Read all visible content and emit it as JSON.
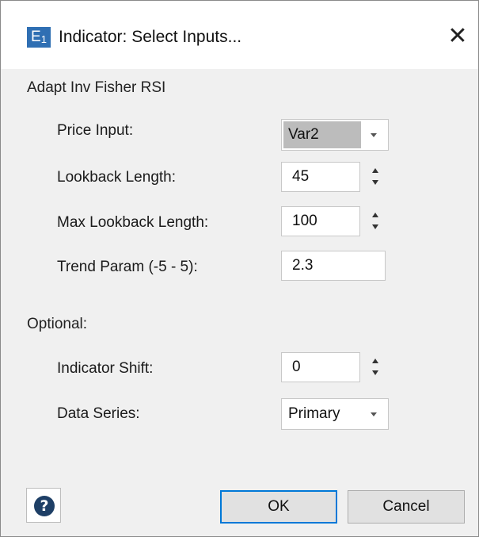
{
  "window": {
    "app_icon_letter": "E",
    "app_icon_sub": "1",
    "title": "Indicator: Select Inputs...",
    "close_glyph": "✕"
  },
  "main": {
    "section_title": "Adapt Inv Fisher RSI",
    "fields": [
      {
        "label": "Price Input:",
        "value": "Var2",
        "type": "dropdown"
      },
      {
        "label": "Lookback Length:",
        "value": "45",
        "type": "spinner"
      },
      {
        "label": "Max Lookback Length:",
        "value": "100",
        "type": "spinner"
      },
      {
        "label": "Trend Param (-5 - 5):",
        "value": "2.3",
        "type": "text"
      }
    ]
  },
  "optional": {
    "section_title": "Optional:",
    "fields": [
      {
        "label": "Indicator Shift:",
        "value": "0",
        "type": "spinner"
      },
      {
        "label": "Data Series:",
        "value": "Primary",
        "type": "dropdown"
      }
    ]
  },
  "footer": {
    "help_glyph": "?",
    "ok_label": "OK",
    "cancel_label": "Cancel"
  },
  "colors": {
    "dialog_bg": "#f0f0f0",
    "titlebar_bg": "#ffffff",
    "app_icon_bg": "#2f6fb3",
    "default_button_border": "#0078d7",
    "help_icon_bg": "#1e3f66"
  },
  "icons": {
    "app": "app-logo-icon",
    "close": "close-icon",
    "help": "help-icon",
    "dropdown": "chevron-down-icon",
    "spin_up": "spin-up-icon",
    "spin_down": "spin-down-icon"
  }
}
